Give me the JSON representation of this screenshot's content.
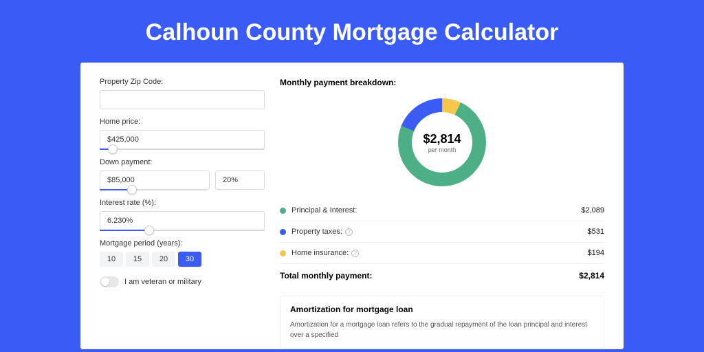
{
  "title": "Calhoun County Mortgage Calculator",
  "form": {
    "zip_label": "Property Zip Code:",
    "zip_value": "",
    "home_price_label": "Home price:",
    "home_price_value": "$425,000",
    "home_price_slider_pct": 8,
    "down_payment_label": "Down payment:",
    "down_payment_value": "$85,000",
    "down_payment_pct_value": "20%",
    "down_payment_slider_pct": 20,
    "interest_label": "Interest rate (%):",
    "interest_value": "6.230%",
    "interest_slider_pct": 30,
    "period_label": "Mortgage period (years):",
    "periods": [
      "10",
      "15",
      "20",
      "30"
    ],
    "period_selected": "30",
    "veteran_label": "I am veteran or military"
  },
  "breakdown": {
    "title": "Monthly payment breakdown:",
    "center_value": "$2,814",
    "center_sub": "per month",
    "items": [
      {
        "label": "Principal & Interest:",
        "value": "$2,089",
        "color": "#4caf86",
        "info": false
      },
      {
        "label": "Property taxes:",
        "value": "$531",
        "color": "#3b5bf5",
        "info": true
      },
      {
        "label": "Home insurance:",
        "value": "$194",
        "color": "#f5c84c",
        "info": true
      }
    ],
    "total_label": "Total monthly payment:",
    "total_value": "$2,814"
  },
  "amortization": {
    "title": "Amortization for mortgage loan",
    "text": "Amortization for a mortgage loan refers to the gradual repayment of the loan principal and interest over a specified"
  },
  "chart_data": {
    "type": "pie",
    "title": "Monthly payment breakdown",
    "series": [
      {
        "name": "Principal & Interest",
        "value": 2089,
        "color": "#4caf86"
      },
      {
        "name": "Property taxes",
        "value": 531,
        "color": "#3b5bf5"
      },
      {
        "name": "Home insurance",
        "value": 194,
        "color": "#f5c84c"
      }
    ],
    "center_label": "$2,814 per month",
    "total": 2814
  }
}
